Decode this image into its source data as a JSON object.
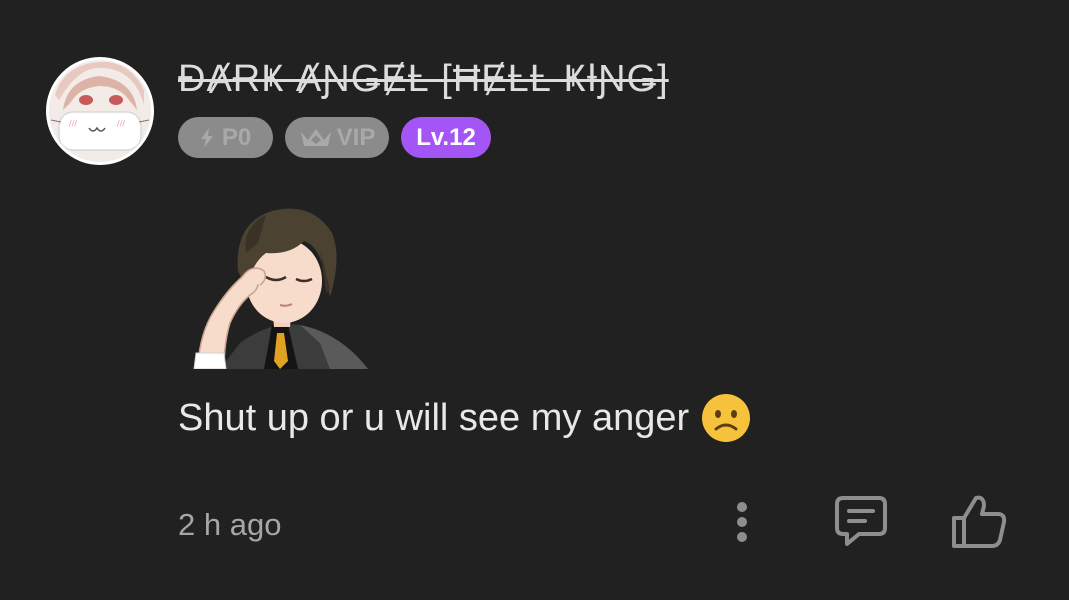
{
  "comment": {
    "username": "ĐȺɌҜ ȺƝǤɆⱠ [ĦɆⱠⱠ ҜƗƝǤ]",
    "badges": {
      "points_label": "P0",
      "vip_label": "VIP",
      "level_label": "Lv.12"
    },
    "text": "Shut up or u will see my anger",
    "emoji": "confused-face-emoji",
    "timestamp": "2 h ago"
  },
  "icons": {
    "lightning": "lightning-icon",
    "crown": "crown-icon",
    "more": "more-vertical-icon",
    "reply": "reply-comment-icon",
    "like": "thumbs-up-icon"
  },
  "colors": {
    "background": "#212121",
    "badge_gray": "#8b8b8b",
    "level_purple": "#a455f5",
    "emoji_yellow": "#f6c23b"
  }
}
